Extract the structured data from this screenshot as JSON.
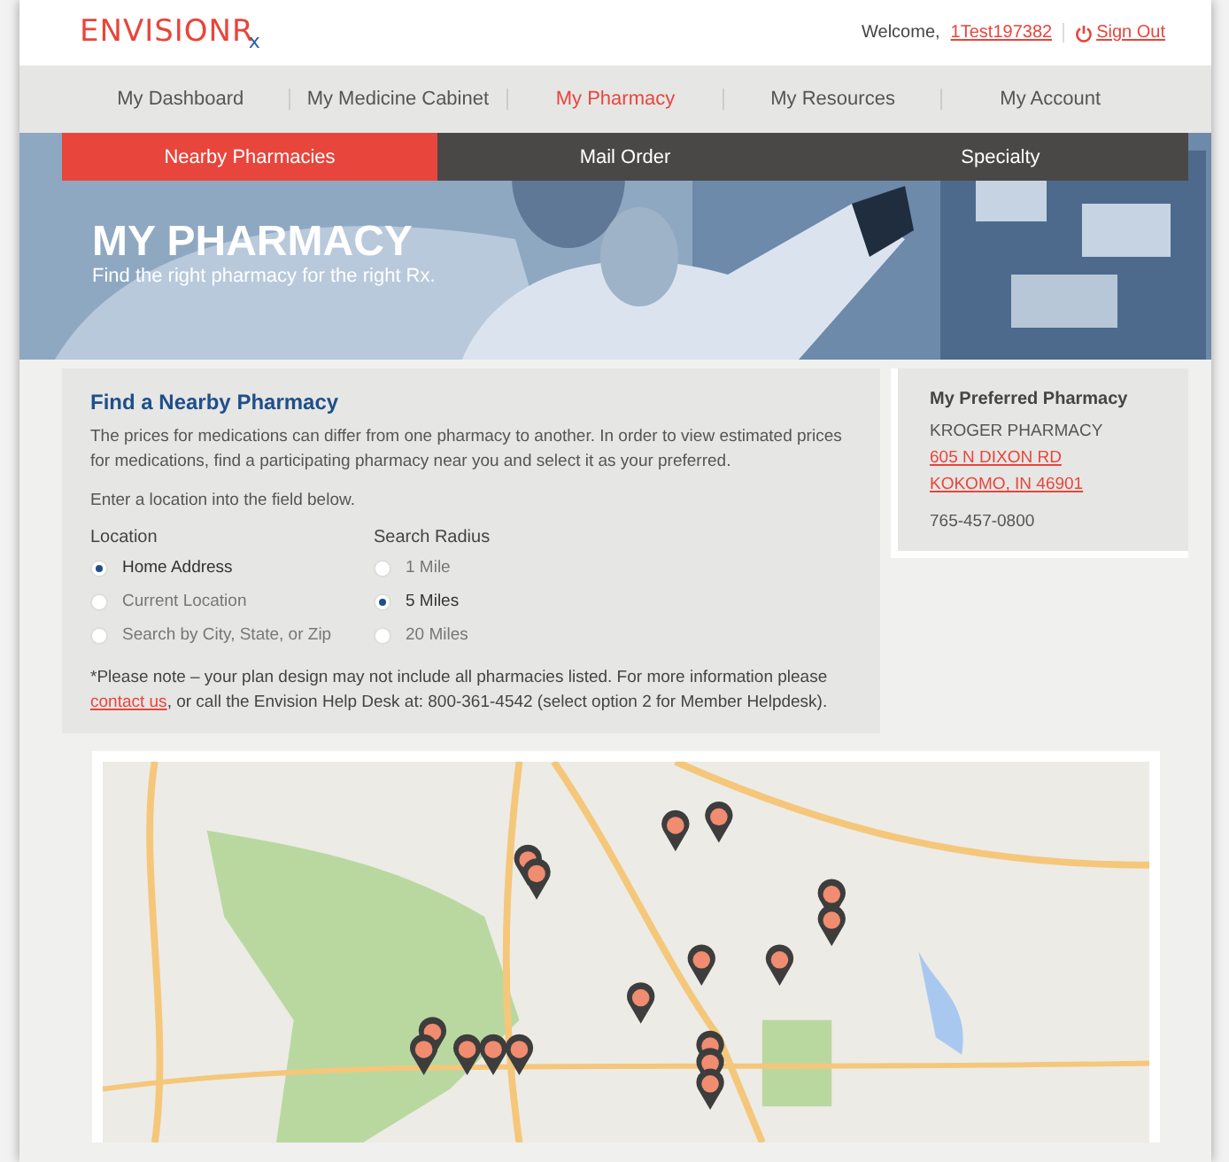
{
  "header": {
    "logo": "ENVISIONR",
    "logo_suffix": "x",
    "welcome": "Welcome,",
    "user": "1Test197382",
    "sign_out": "Sign Out"
  },
  "nav": [
    {
      "label": "My Dashboard",
      "selected": false
    },
    {
      "label": "My Medicine Cabinet",
      "selected": false
    },
    {
      "label": "My Pharmacy",
      "selected": true
    },
    {
      "label": "My Resources",
      "selected": false
    },
    {
      "label": "My Account",
      "selected": false
    }
  ],
  "subtabs": [
    {
      "label": "Nearby Pharmacies",
      "selected": true
    },
    {
      "label": "Mail Order",
      "selected": false
    },
    {
      "label": "Specialty",
      "selected": false
    }
  ],
  "hero": {
    "kind": "picture",
    "title": "MY PHARMACY",
    "subtitle": "Find the right pharmacy for the right Rx."
  },
  "finder": {
    "title": "Find a Nearby Pharmacy",
    "intro": "The prices for medications can differ from one pharmacy to another. In order to view estimated prices for medications, find a participating pharmacy near you and select it as your preferred.",
    "instruction": "Enter a location into the field below.",
    "groups": [
      {
        "label": "Location",
        "options": [
          {
            "label": "Home Address",
            "selected": true
          },
          {
            "label": "Current Location",
            "selected": false
          },
          {
            "label": "Search by City, State, or Zip",
            "selected": false
          }
        ]
      },
      {
        "label": "Search Radius",
        "options": [
          {
            "label": "1 Mile",
            "selected": false
          },
          {
            "label": "5 Miles",
            "selected": true
          },
          {
            "label": "20 Miles",
            "selected": false
          }
        ]
      }
    ],
    "note": "*Please note – your plan design may not include all pharmacies listed. For more information please",
    "note_link": "contact us",
    "note_rest": ", or call the Envision Help Desk at: 800-361-4542 (select option 2 for Member Helpdesk)."
  },
  "preferred": {
    "title": "My Preferred Pharmacy",
    "name": "KROGER PHARMACY",
    "address_lines": [
      "605 N DIXON RD",
      "KOKOMO, IN 46901"
    ],
    "phone": "765-457-0800"
  }
}
